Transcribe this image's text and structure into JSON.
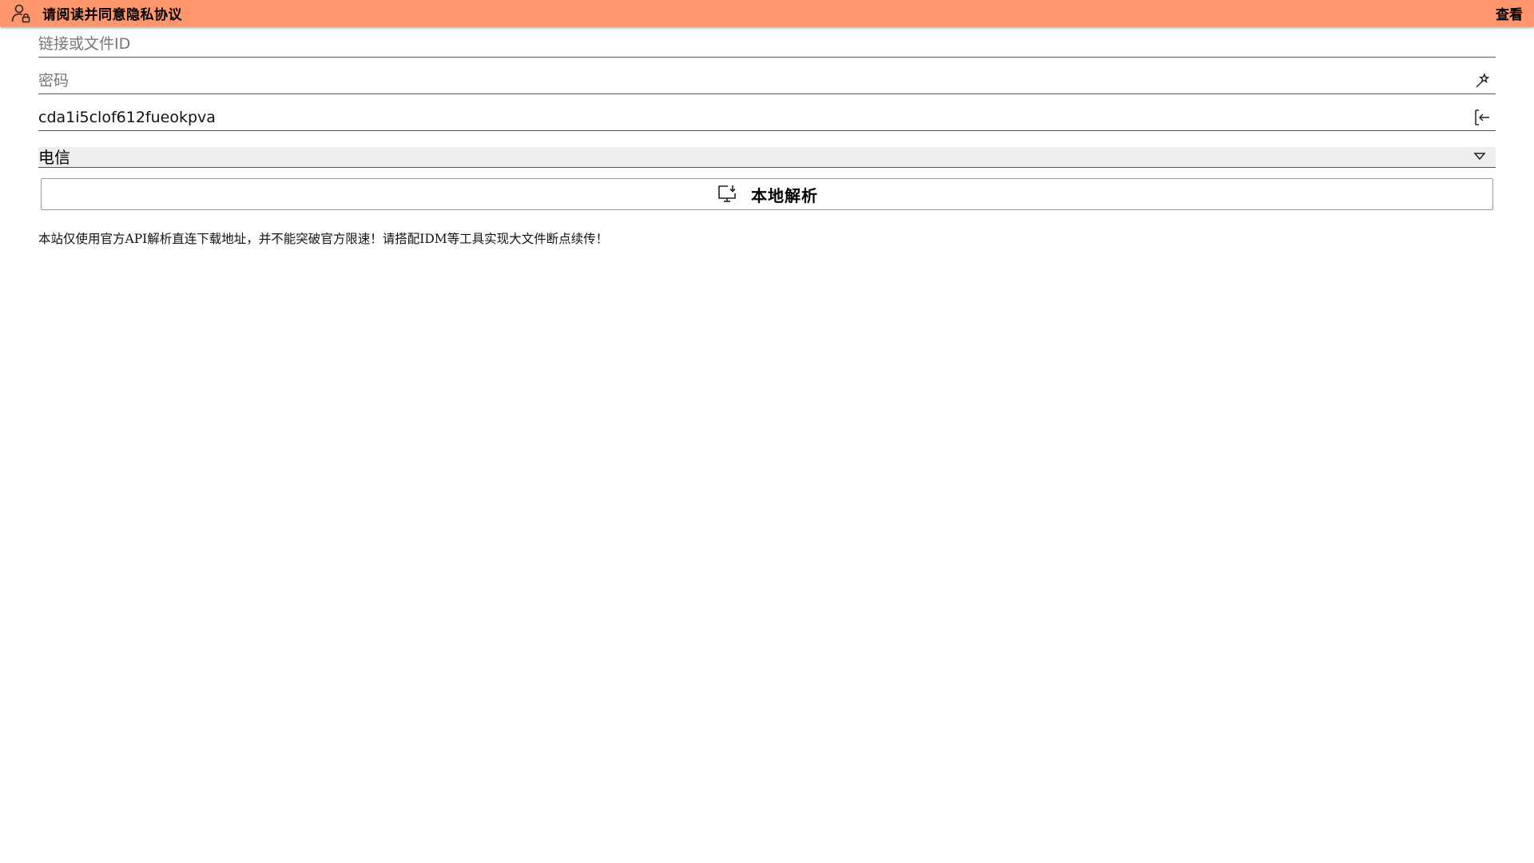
{
  "banner": {
    "title": "请阅读并同意隐私协议",
    "action_label": "查看",
    "background_color": "#ff966c",
    "icon": "user-lock-icon"
  },
  "form": {
    "link_input": {
      "value": "",
      "placeholder": "链接或文件ID"
    },
    "password_input": {
      "value": "",
      "placeholder": "密码",
      "trailing_icon": "magic-wand-icon"
    },
    "code_input": {
      "value": "cda1i5clof612fueokpva",
      "placeholder": "",
      "trailing_icon": "login-icon"
    },
    "line_select": {
      "selected": "电信",
      "icon": "dropdown-caret-icon"
    },
    "parse_button": {
      "label": "本地解析",
      "icon": "monitor-download-icon"
    }
  },
  "notice": {
    "text": "本站仅使用官方API解析直连下载地址，并不能突破官方限速！请搭配IDM等工具实现大文件断点续传！"
  }
}
